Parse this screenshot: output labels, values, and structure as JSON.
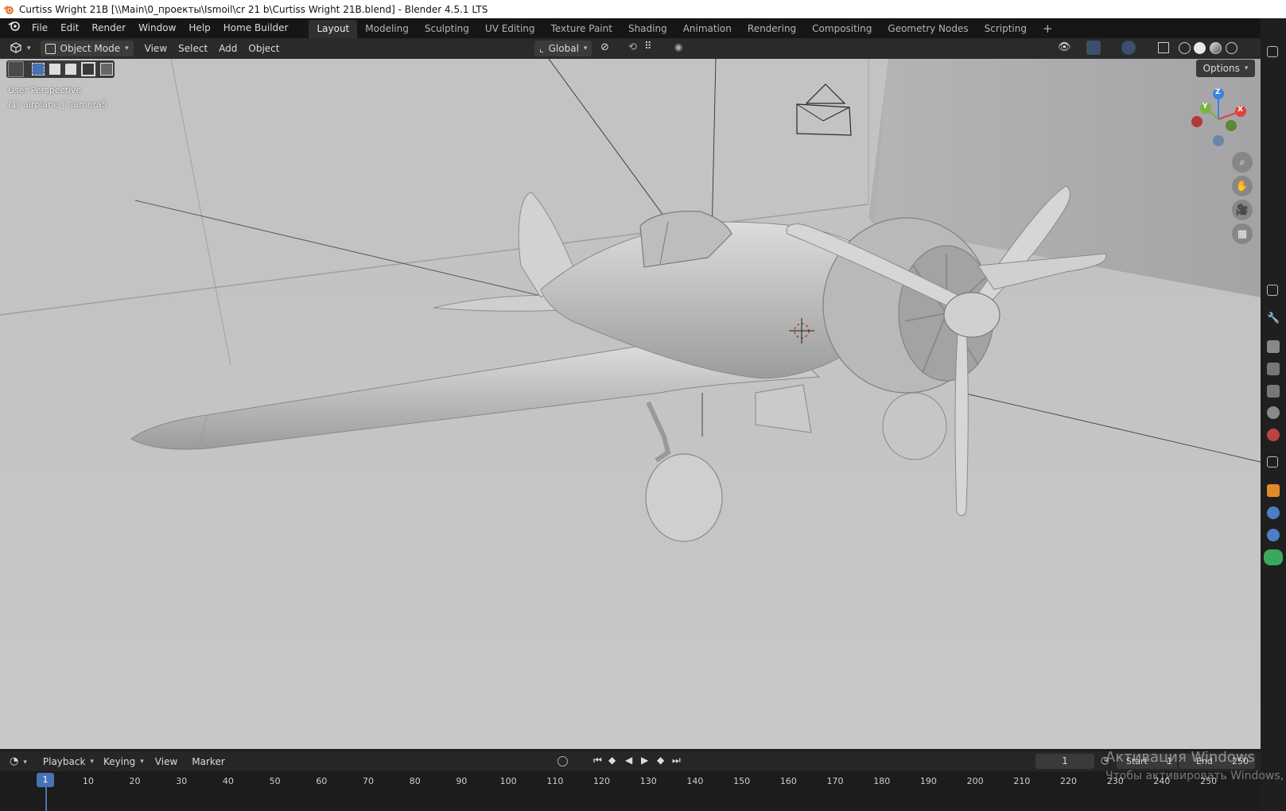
{
  "window": {
    "title": "Curtiss Wright 21B [\\\\Main\\0_проекты\\Ismoil\\cr 21 b\\Curtiss Wright 21B.blend] - Blender 4.5.1 LTS"
  },
  "menu": {
    "items": [
      "File",
      "Edit",
      "Render",
      "Window",
      "Help",
      "Home Builder"
    ]
  },
  "workspaces": {
    "tabs": [
      "Layout",
      "Modeling",
      "Sculpting",
      "UV Editing",
      "Texture Paint",
      "Shading",
      "Animation",
      "Rendering",
      "Compositing",
      "Geometry Nodes",
      "Scripting"
    ],
    "active": "Layout",
    "add_symbol": "+"
  },
  "viewport_header": {
    "mode": "Object Mode",
    "menus": [
      "View",
      "Select",
      "Add",
      "Object"
    ],
    "transform_orientation": "Global",
    "options_label": "Options"
  },
  "viewport": {
    "perspective_label": "User Perspective",
    "object_label": "(1) airplane | Camera5",
    "gizmo_axes": [
      "Z",
      "Y",
      "X"
    ],
    "background_color": "#c6c6c8"
  },
  "timeline": {
    "menus": [
      "Playback",
      "Keying",
      "View",
      "Marker"
    ],
    "current_frame": "1",
    "start_label": "Start",
    "start_value": "1",
    "end_label": "End",
    "end_value": "250",
    "ruler": [
      "10",
      "20",
      "30",
      "40",
      "50",
      "60",
      "70",
      "80",
      "90",
      "100",
      "110",
      "120",
      "130",
      "140",
      "150",
      "160",
      "170",
      "180",
      "190",
      "200",
      "210",
      "220",
      "230",
      "240",
      "250"
    ]
  },
  "watermark": {
    "line1": "Активация Windows",
    "line2": "Чтобы активировать Windows, п"
  },
  "icons": {
    "blender": "blender-logo-icon",
    "editor_type": "3d-viewport-icon",
    "gizmo": "navigation-gizmo-icon"
  },
  "colors": {
    "accent": "#4772b3",
    "active_tab": "#303030",
    "axis_x": "#e0413d",
    "axis_y": "#7bb33c",
    "axis_z": "#3a84e0"
  }
}
